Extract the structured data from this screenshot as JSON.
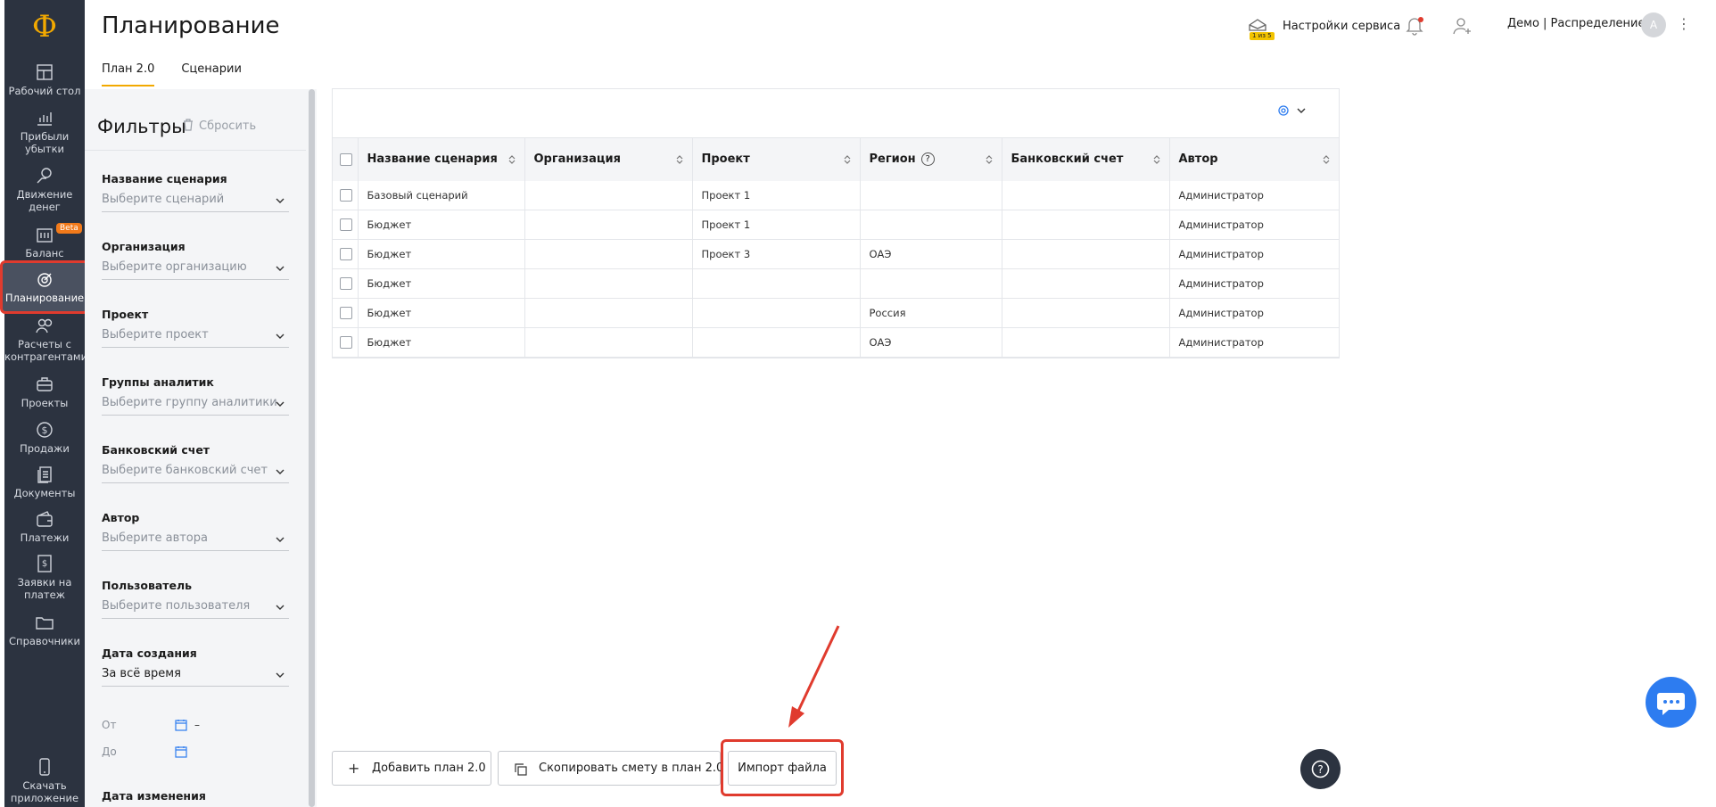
{
  "app": {
    "logo": "Ф",
    "page_title": "Планирование"
  },
  "nav": [
    {
      "label": "Рабочий стол",
      "icon": "desktop-icon"
    },
    {
      "label": "Прибыли убытки",
      "icon": "chart-icon"
    },
    {
      "label": "Движение денег",
      "icon": "money-flow-icon"
    },
    {
      "label": "Баланс",
      "icon": "balance-icon",
      "badge": "Beta"
    },
    {
      "label": "Планирование",
      "icon": "target-icon",
      "active": true
    },
    {
      "label": "Расчеты с контрагентами",
      "icon": "contractors-icon"
    },
    {
      "label": "Проекты",
      "icon": "briefcase-icon"
    },
    {
      "label": "Продажи",
      "icon": "dollar-icon"
    },
    {
      "label": "Документы",
      "icon": "documents-icon"
    },
    {
      "label": "Платежи",
      "icon": "wallet-icon"
    },
    {
      "label": "Заявки на платеж",
      "icon": "request-icon"
    },
    {
      "label": "Справочники",
      "icon": "folder-icon"
    },
    {
      "label": "Скачать приложение",
      "icon": "phone-icon"
    }
  ],
  "tabs": [
    {
      "label": "План 2.0",
      "active": true
    },
    {
      "label": "Сценарии",
      "active": false
    }
  ],
  "header": {
    "service_settings": "Настройки сервиса",
    "service_badge": "1 из 5",
    "account": "Демо | Распределение",
    "avatar_letter": "А"
  },
  "filters": {
    "title": "Фильтры",
    "reset": "Сбросить",
    "groups": [
      {
        "label": "Название сценария",
        "placeholder": "Выберите сценарий"
      },
      {
        "label": "Организация",
        "placeholder": "Выберите организацию"
      },
      {
        "label": "Проект",
        "placeholder": "Выберите проект"
      },
      {
        "label": "Группы аналитик",
        "placeholder": "Выберите группу аналитики"
      },
      {
        "label": "Банковский счет",
        "placeholder": "Выберите банковский счет"
      },
      {
        "label": "Автор",
        "placeholder": "Выберите автора"
      },
      {
        "label": "Пользователь",
        "placeholder": "Выберите пользователя"
      },
      {
        "label": "Дата создания",
        "value": "За всё время"
      }
    ],
    "date_from": "От",
    "date_to": "До",
    "date_dash": "–",
    "next_group": "Дата изменения"
  },
  "table": {
    "columns": [
      "Название сценария",
      "Организация",
      "Проект",
      "Регион",
      "Банковский счет",
      "Автор"
    ],
    "rows": [
      [
        "Базовый сценарий",
        "",
        "Проект 1",
        "",
        "",
        "Администратор"
      ],
      [
        "Бюджет",
        "",
        "Проект 1",
        "",
        "",
        "Администратор"
      ],
      [
        "Бюджет",
        "",
        "Проект 3",
        "ОАЭ",
        "",
        "Администратор"
      ],
      [
        "Бюджет",
        "",
        "",
        "",
        "",
        "Администратор"
      ],
      [
        "Бюджет",
        "",
        "",
        "Россия",
        "",
        "Администратор"
      ],
      [
        "Бюджет",
        "",
        "",
        "ОАЭ",
        "",
        "Администратор"
      ]
    ]
  },
  "buttons": {
    "add_plan": "Добавить план 2.0",
    "copy_estimate": "Скопировать смету в план 2.0",
    "import_file": "Импорт файла"
  },
  "colors": {
    "accent": "#f2a900",
    "nav_bg": "#2c3340",
    "highlight": "#e03b2e",
    "chat": "#2d7cf0"
  }
}
